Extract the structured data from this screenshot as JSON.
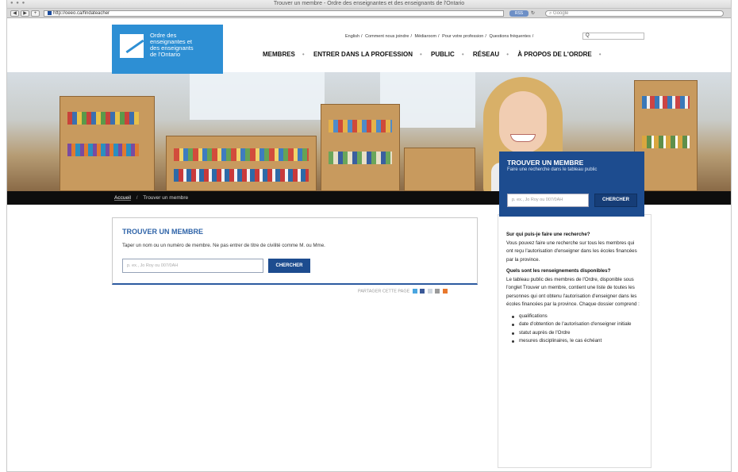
{
  "browser": {
    "title": "Trouver un membre - Ordre des enseignantes et des enseignants de l'Ontario",
    "url": "http://oeeo.ca/findateacher",
    "rss": "RSS",
    "google_placeholder": "Google"
  },
  "header": {
    "logo_lines": [
      "Ordre des",
      "enseignantes et",
      "des enseignants",
      "de l'Ontario"
    ],
    "utility_links": [
      "English",
      "Comment nous joindre",
      "Médiaroom",
      "Pour votre profession",
      "Questions fréquentes"
    ],
    "search_placeholder": "Q",
    "nav": [
      "MEMBRES",
      "ENTRER DANS LA PROFESSION",
      "PUBLIC",
      "RÉSEAU",
      "À PROPOS DE L'ORDRE"
    ]
  },
  "find_panel": {
    "heading": "TROUVER UN MEMBRE",
    "subtitle": "Faire une recherche dans le tableau public",
    "placeholder": "p. ex., Jo Roy ou 007/0AH",
    "button": "CHERCHER"
  },
  "breadcrumb": {
    "home": "Accueil",
    "separator": "/",
    "current": "Trouver un membre"
  },
  "card": {
    "heading": "TROUVER UN MEMBRE",
    "description": "Taper un nom ou un numéro de membre. Ne pas entrer de titre de civilité comme M. ou Mme.",
    "placeholder": "p. ex., Jo Roy ou 007/0AH",
    "button": "CHERCHER"
  },
  "share": {
    "label": "PARTAGER CETTE PAGE"
  },
  "sidebar": {
    "q1": "Sur qui puis-je faire une recherche?",
    "a1": "Vous pouvez faire une recherche sur tous les membres qui ont reçu l'autorisation d'enseigner dans les écoles financées par la province.",
    "q2": "Quels sont les renseignements disponibles?",
    "a2": "Le tableau public des membres de l'Ordre, disponible sous l'onglet Trouver un membre, contient une liste de toutes les personnes qui ont obtenu l'autorisation d'enseigner dans les écoles financées par la province. Chaque dossier comprend :",
    "bullets": [
      "qualifications",
      "date d'obtention de l'autorisation d'enseigner initiale",
      "statut auprès de l'Ordre",
      "mesures disciplinaires, le cas échéant"
    ]
  }
}
